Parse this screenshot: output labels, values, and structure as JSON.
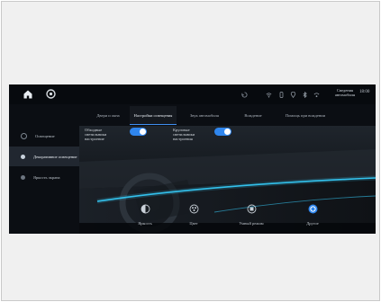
{
  "status_bar": {
    "clock": "18:00",
    "car_settings_label": "Сведения автомобиля",
    "icons": [
      "sync-icon",
      "wifi-icon",
      "phone-icon",
      "location-icon",
      "bluetooth-icon",
      "signal-icon"
    ]
  },
  "tabs": [
    {
      "label": "Двери и окна",
      "active": false
    },
    {
      "label": "Настройки освещения",
      "active": true
    },
    {
      "label": "Звук автомобиля",
      "active": false
    },
    {
      "label": "Вождение",
      "active": false
    },
    {
      "label": "Помощь при вождении",
      "active": false
    }
  ],
  "side_menu": [
    {
      "label": "Освещение",
      "selected": false
    },
    {
      "label": "Декоративное освещение",
      "selected": true
    },
    {
      "label": "Яркость экрана",
      "selected": false
    }
  ],
  "settings": {
    "toggle1_label": "Обходные светильники настроение",
    "toggle1_on": true,
    "toggle2_label": "Круговые светильники настроения",
    "toggle2_on": true
  },
  "bottom_controls": [
    {
      "label": "Яркость",
      "icon": "brightness-icon"
    },
    {
      "label": "Цвет",
      "icon": "color-icon"
    },
    {
      "label": "Умный режим",
      "icon": "smart-mode-icon"
    },
    {
      "label": "Другое",
      "icon": "other-icon"
    }
  ],
  "colors": {
    "accent": "#2f86ee",
    "background": "#0b0e13",
    "ambient_light": "#36d0ff"
  }
}
